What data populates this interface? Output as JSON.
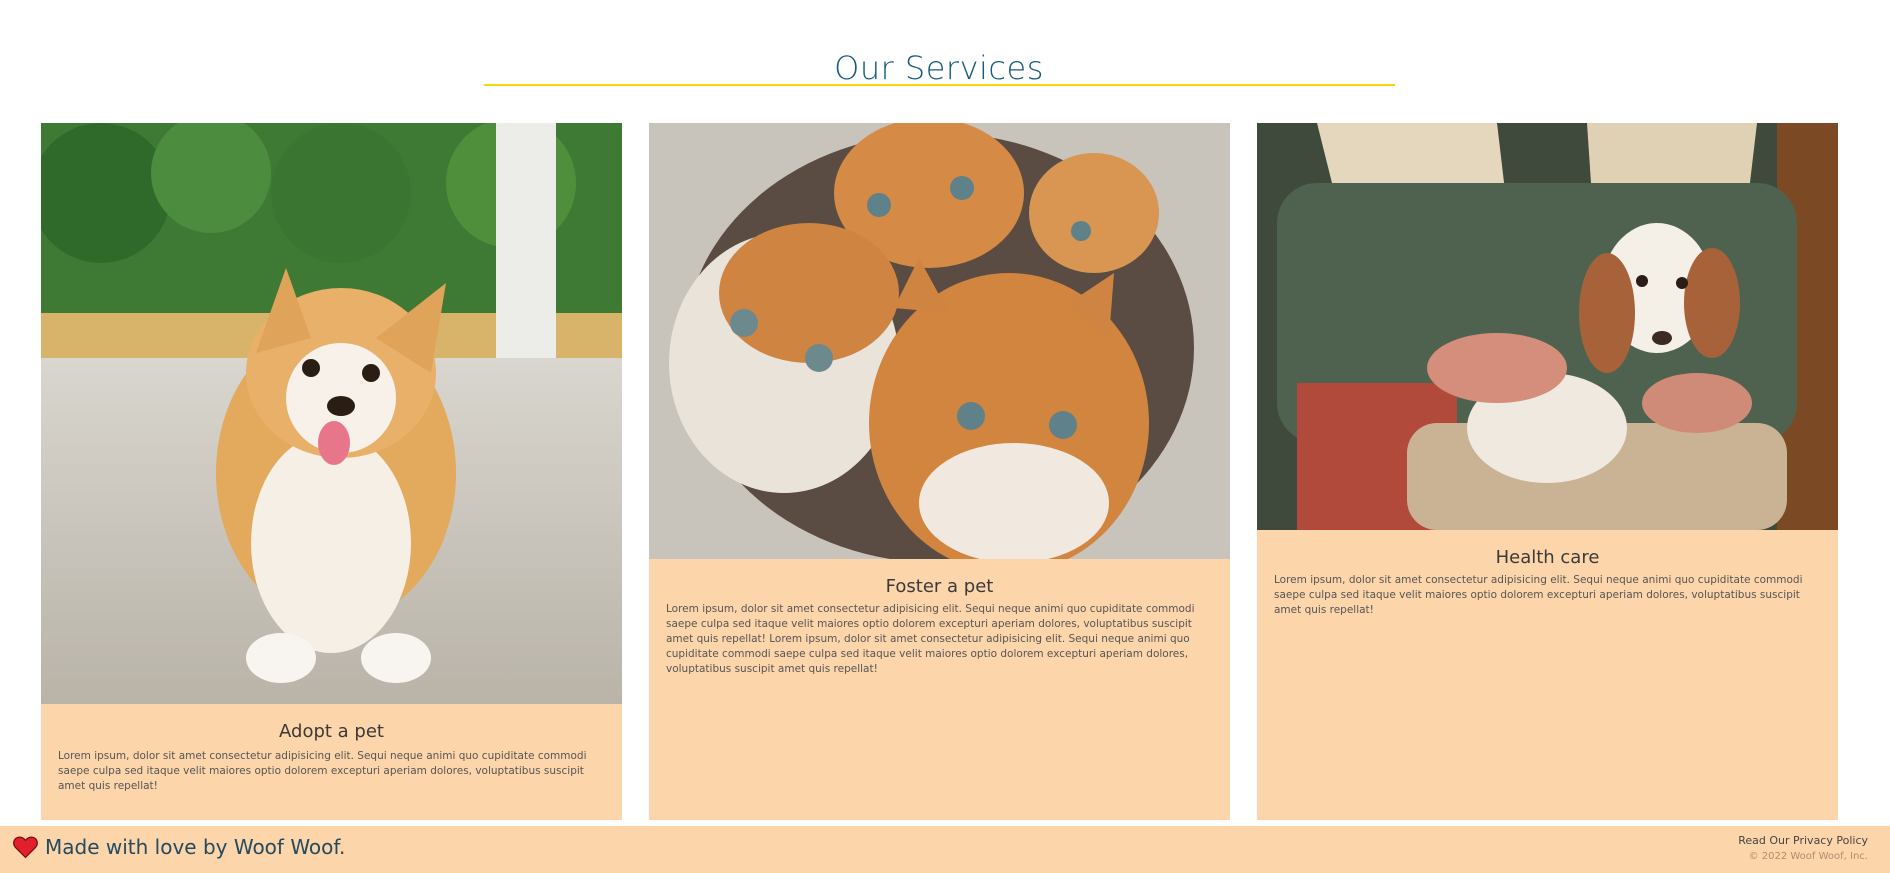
{
  "page": {
    "title": "Our Services"
  },
  "services": [
    {
      "title": "Adopt a pet",
      "text": "Lorem ipsum, dolor sit amet consectetur adipisicing elit. Sequi neque animi quo cupiditate commodi saepe culpa sed itaque velit maiores optio dolorem excepturi aperiam dolores, voluptatibus suscipit amet quis repellat!",
      "image": "corgi-puppy-photo"
    },
    {
      "title": "Foster a pet",
      "text": "Lorem ipsum, dolor sit amet consectetur adipisicing elit. Sequi neque animi quo cupiditate commodi saepe culpa sed itaque velit maiores optio dolorem excepturi aperiam dolores, voluptatibus suscipit amet quis repellat! Lorem ipsum, dolor sit amet consectetur adipisicing elit. Sequi neque animi quo cupiditate commodi saepe culpa sed itaque velit maiores optio dolorem excepturi aperiam dolores, voluptatibus suscipit amet quis repellat!",
      "image": "kittens-photo"
    },
    {
      "title": "Health care",
      "text": "Lorem ipsum, dolor sit amet consectetur adipisicing elit. Sequi neque animi quo cupiditate commodi saepe culpa sed itaque velit maiores optio dolorem excepturi aperiam dolores, voluptatibus suscipit amet quis repellat!",
      "image": "spaniel-puppy-lap-photo"
    }
  ],
  "footer": {
    "made_with": "Made with love by Woof Woof.",
    "links": "Read Our Privacy Policy",
    "copyright": "© 2022 Woof Woof, Inc."
  },
  "colors": {
    "title": "#165a7d",
    "accent_rule": "#f5d90a",
    "card_bg": "#fdd5aa",
    "heart": "#e0202a"
  },
  "icons": {
    "footer_heart": "heart-icon"
  }
}
